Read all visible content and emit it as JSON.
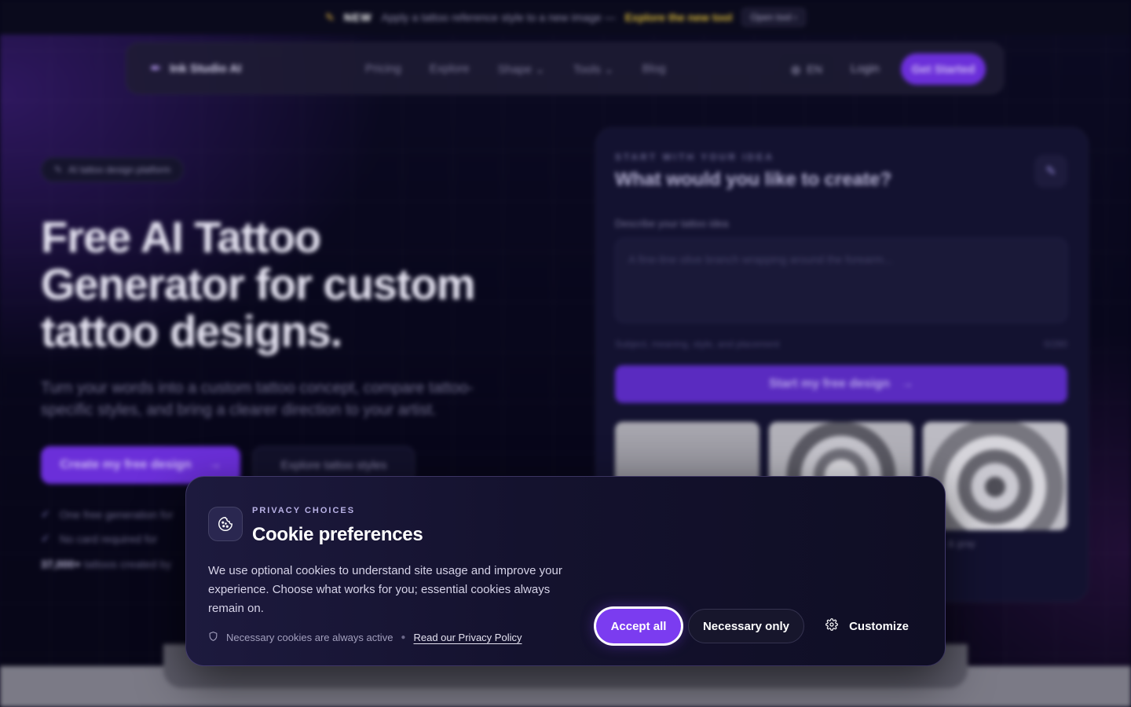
{
  "announcement": {
    "badge": "NEW",
    "text": "Apply a tattoo reference style to a new image —",
    "link": "Explore the new tool",
    "button": "Open tool"
  },
  "nav": {
    "brand": "Ink Studio AI",
    "links": [
      "Pricing",
      "Explore",
      "Shape",
      "Tools",
      "Blog"
    ],
    "language": "EN",
    "login": "Login",
    "cta": "Get Started"
  },
  "hero": {
    "pill": "AI tattoo design platform",
    "title_lines": [
      "Free AI Tattoo",
      "Generator for custom",
      "tattoo designs."
    ],
    "subtitle": "Turn your words into a custom tattoo concept, compare tattoo-specific styles, and bring a clearer direction to your artist.",
    "cta_primary": "Create my free design",
    "cta_secondary": "Explore tattoo styles",
    "checks": [
      "One free generation for",
      "No card required for"
    ],
    "count_value": "37,000+",
    "count_text": "tattoos created by"
  },
  "create_panel": {
    "eyebrow": "START WITH YOUR IDEA",
    "question": "What would you like to create?",
    "field_label": "Describe your tattoo idea",
    "placeholder": "A fine-line olive branch wrapping around the forearm...",
    "helper": "Subject, meaning, style, and placement",
    "counter": "0/280",
    "button": "Start my free design",
    "thumb_caption": "& gray"
  },
  "cookie": {
    "eyebrow": "PRIVACY CHOICES",
    "title": "Cookie preferences",
    "body": "We use optional cookies to understand site usage and improve your experience. Choose what works for you; essential cookies always remain on.",
    "always_active": "Necessary cookies are always active",
    "policy_link": "Read our Privacy Policy",
    "accept_all": "Accept all",
    "necessary_only": "Necessary only",
    "customize": "Customize"
  },
  "colors": {
    "accent": "#7b3cf0",
    "dialog_bg": "#14122e",
    "page_bg": "#07061a"
  },
  "icons": {
    "cookie": "cookie-icon",
    "shield": "shield-icon",
    "gear": "gear-icon",
    "arrow": "arrow-right-icon",
    "wand": "wand-icon",
    "globe": "globe-icon",
    "spark": "sparkle-icon"
  }
}
